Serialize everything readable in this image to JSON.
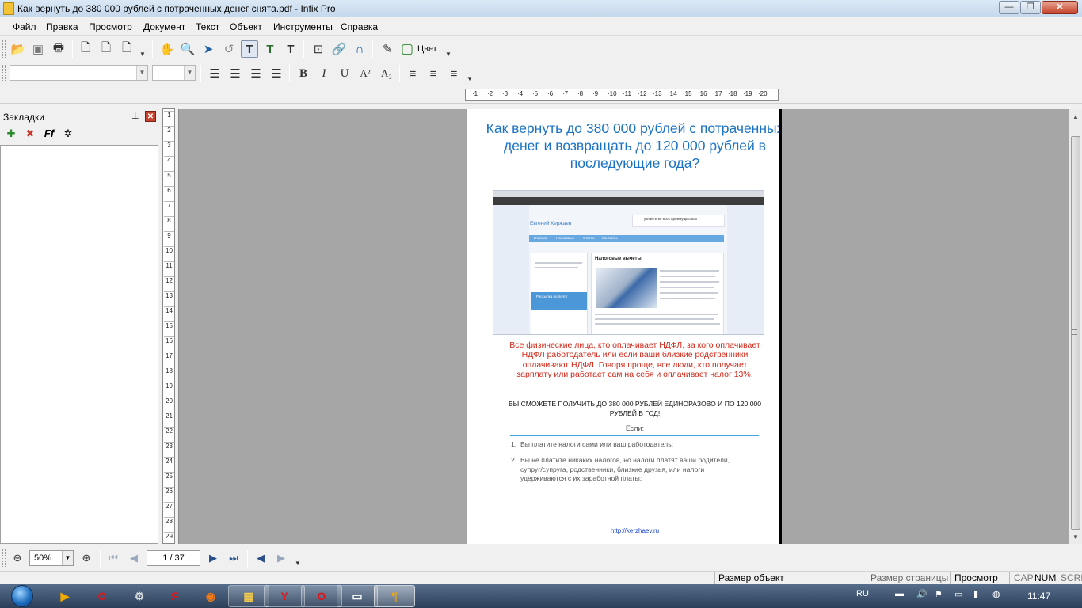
{
  "window": {
    "title": "Как вернуть до 380 000 рублей с потраченных денег снята.pdf - Infix Pro",
    "minimize": "—",
    "maximize": "❐",
    "close": "✕"
  },
  "menu": [
    "Файл",
    "Правка",
    "Просмотр",
    "Документ",
    "Текст",
    "Объект",
    "Инструменты",
    "Справка"
  ],
  "toolbar": {
    "icons": [
      "open-icon",
      "save-icon",
      "print-icon",
      "new-page-icon",
      "page-icon",
      "page-dropdown-icon",
      "hand-icon",
      "zoom-icon",
      "select-arrow-icon",
      "rotate-icon",
      "text-tool-icon",
      "text-edit-icon",
      "text-format-icon",
      "crop-icon",
      "hyperlink-icon",
      "undo-icon",
      "eyedropper-icon",
      "color-swatch-icon"
    ],
    "color_label": "Цвет",
    "bold": "B",
    "italic": "I",
    "underline": "U",
    "superscript": "A²",
    "subscript": "A₂"
  },
  "ruler_ticks": [
    "1",
    "2",
    "3",
    "4",
    "5",
    "6",
    "7",
    "8",
    "9",
    "10",
    "11",
    "12",
    "13",
    "14",
    "15",
    "16",
    "17",
    "18",
    "19",
    "20"
  ],
  "bookmarks": {
    "title": "Закладки",
    "pin": "📌",
    "close": "✕",
    "tools": [
      "add-bookmark-icon",
      "delete-bookmark-icon",
      "font-bookmark-icon",
      "magic-bookmark-icon"
    ]
  },
  "vruler_ticks": [
    "1",
    "2",
    "3",
    "4",
    "5",
    "6",
    "7",
    "8",
    "9",
    "10",
    "11",
    "12",
    "13",
    "14",
    "15",
    "16",
    "17",
    "18",
    "19",
    "20",
    "21",
    "22",
    "23",
    "24",
    "25",
    "26",
    "27",
    "28",
    "29"
  ],
  "pdf": {
    "title": "Как вернуть до 380 000 рублей с потраченных денег и возвращать до 120 000 рублей в последующие года?",
    "screenshot": {
      "brand": "Евгений Кержаев",
      "nav": [
        "Главная",
        "Налоговые",
        "Статьи",
        "Контакты"
      ],
      "heading": "Налоговые вычеты",
      "top_text": "узнайте во всех преимуществах",
      "subscribe": "Рассылка по почту"
    },
    "red_text": "Все физические лица, кто оплачивает НДФЛ, за кого оплачивает НДФЛ работодатель или если ваши близкие родственники оплачивают НДФЛ. Говоря проще, все люди, кто получает зарплату или работает сам на себя и оплачивает налог 13%.",
    "bold_text": "ВЫ СМОЖЕТЕ ПОЛУЧИТЬ ДО 380 000 РУБЛЕЙ ЕДИНОРАЗОВО И ПО 120 000 РУБЛЕЙ В ГОД!",
    "if_label": "Если:",
    "list": [
      {
        "num": "1.",
        "text": "Вы платите налоги сами или ваш работодатель;"
      },
      {
        "num": "2.",
        "text": "Вы не платите никаких налогов, но налоги платят ваши родители, супруг/супруга, родственники, близкие друзья, или налоги удерживаются с их заработной платы;"
      }
    ],
    "link": "http://kerzhaev.ru"
  },
  "navbar": {
    "zoom": "50%",
    "page": "1 / 37"
  },
  "status": {
    "object_size": "Размер объект",
    "page_size": "Размер страницы",
    "view": "Просмотр",
    "cap": "CAP",
    "num": "NUM",
    "scrl": "SCRL"
  },
  "taskbar": {
    "lang": "RU",
    "clock": "11:47",
    "apps": [
      "media-player-icon",
      "opera-icon",
      "network-tool-icon",
      "yandex-icon",
      "firefox-icon",
      "explorer-icon",
      "yandex-browser-icon",
      "opera-icon",
      "window-app-icon",
      "infix-icon"
    ]
  }
}
